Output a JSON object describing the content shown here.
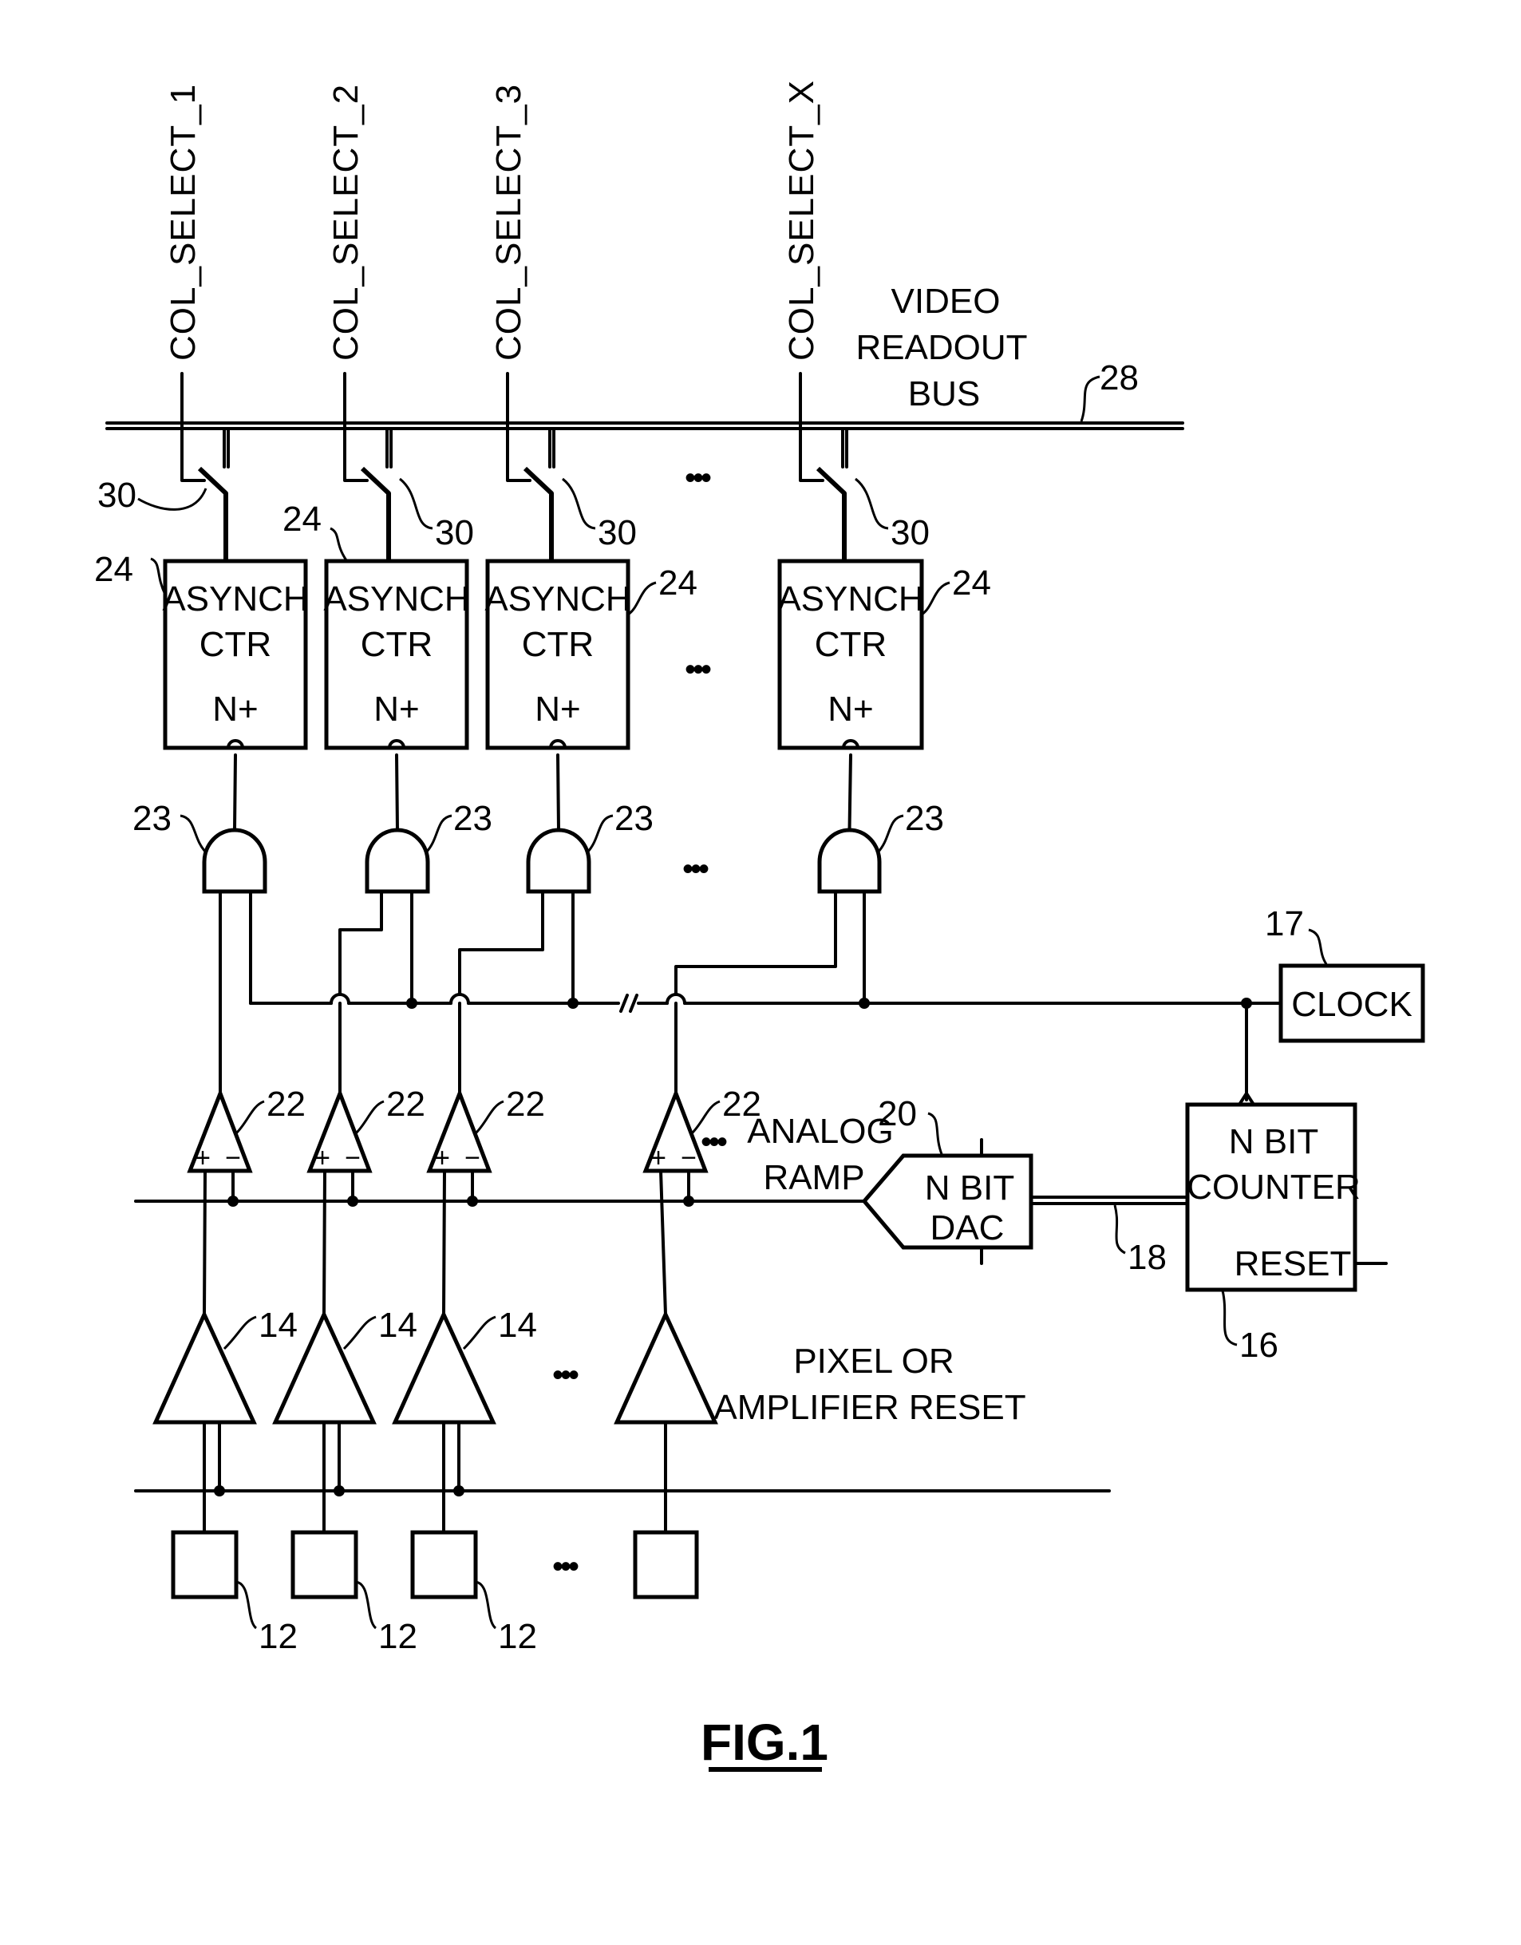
{
  "figure": {
    "caption": "FIG.1",
    "bus_label": [
      "VIDEO",
      "READOUT",
      "BUS"
    ],
    "bus_ref": "28",
    "column_selects": [
      "COL_SELECT_1",
      "COL_SELECT_2",
      "COL_SELECT_3",
      "COL_SELECT_X"
    ],
    "switch_ref": "30",
    "counter_block": {
      "lines": [
        "ASYNCH",
        "CTR",
        "N+"
      ],
      "ref": "24"
    },
    "and_gate_ref": "23",
    "comparator_ref": "22",
    "comparator_signs": [
      "+",
      "−"
    ],
    "amplifier_ref": "14",
    "pixel_ref": "12",
    "clock": {
      "label": "CLOCK",
      "ref": "17"
    },
    "dac": {
      "lines": [
        "N  BIT",
        "DAC"
      ],
      "ref": "20"
    },
    "dac_bus_ref": "18",
    "n_bit_counter": {
      "lines": [
        "N  BIT",
        "COUNTER",
        "RESET"
      ],
      "ref": "16"
    },
    "ramp_label": [
      "ANALOG",
      "RAMP"
    ],
    "reset_label": [
      "PIXEL  OR",
      "AMPLIFIER  RESET"
    ],
    "ellipsis": "•••"
  }
}
